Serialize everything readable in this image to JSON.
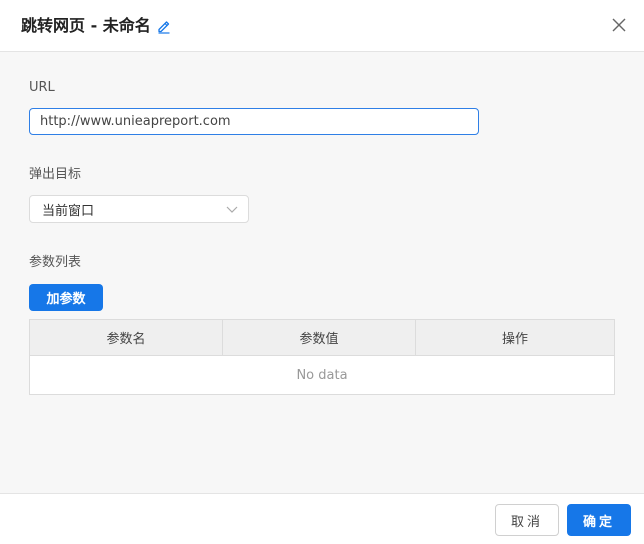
{
  "dialog": {
    "title": "跳转网页 - 未命名",
    "edit_icon": "pencil-icon",
    "close_icon": "close-icon"
  },
  "form": {
    "url_label": "URL",
    "url_value": "http://www.unieapreport.com",
    "target_label": "弹出目标",
    "target_value": "当前窗口",
    "params_label": "参数列表",
    "add_param_label": "加参数"
  },
  "table": {
    "columns": [
      "参数名",
      "参数值",
      "操作"
    ],
    "empty_text": "No data"
  },
  "footer": {
    "cancel_label": "取消",
    "ok_label": "确定"
  },
  "colors": {
    "primary": "#1677e8",
    "body_bg": "#f7f7f7"
  }
}
